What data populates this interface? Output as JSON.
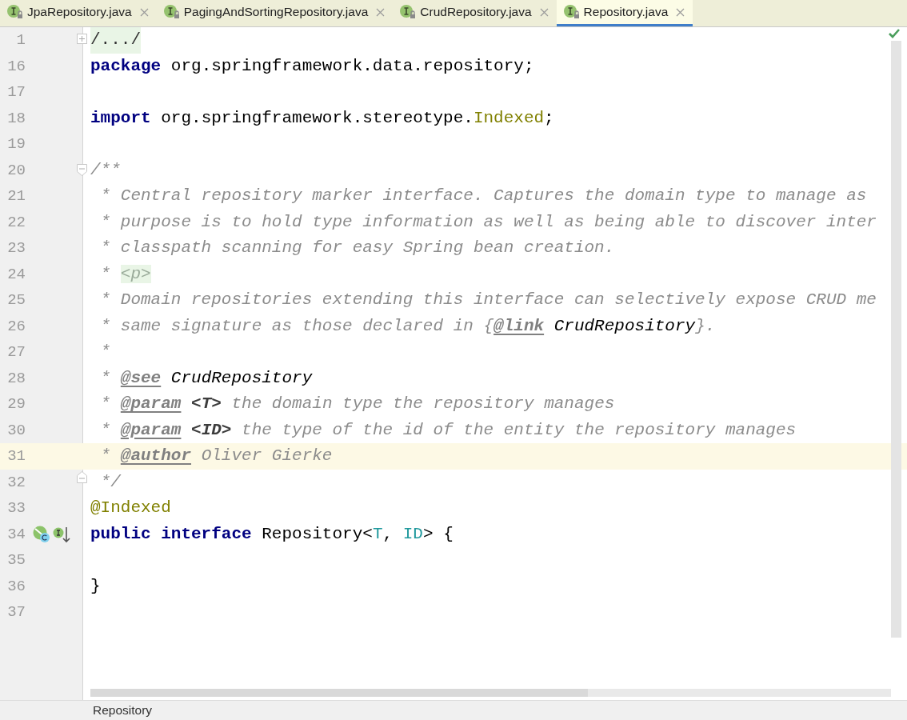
{
  "tabs": [
    {
      "label": "JpaRepository.java",
      "selected": false
    },
    {
      "label": "PagingAndSortingRepository.java",
      "selected": false
    },
    {
      "label": "CrudRepository.java",
      "selected": false
    },
    {
      "label": "Repository.java",
      "selected": true
    }
  ],
  "editor": {
    "lines": [
      {
        "number": "1",
        "current": false,
        "fold": {
          "kind": "expand"
        },
        "tokens": [
          {
            "kind": "folded",
            "text": "/.../"
          }
        ]
      },
      {
        "number": "16",
        "current": false,
        "tokens": [
          {
            "kind": "keyword",
            "text": "package"
          },
          {
            "kind": "plain",
            "text": " org.springframework.data.repository;"
          }
        ]
      },
      {
        "number": "17",
        "current": false
      },
      {
        "number": "18",
        "current": false,
        "tokens": [
          {
            "kind": "keyword",
            "text": "import"
          },
          {
            "kind": "plain",
            "text": " org.springframework.stereotype."
          },
          {
            "kind": "annotation",
            "text": "Indexed"
          },
          {
            "kind": "plain",
            "text": ";"
          }
        ]
      },
      {
        "number": "19",
        "current": false
      },
      {
        "number": "20",
        "current": false,
        "fold": {
          "kind": "start"
        },
        "tokens": [
          {
            "kind": "comment",
            "text": "/**"
          }
        ]
      },
      {
        "number": "21",
        "current": false,
        "tokens": [
          {
            "kind": "comment",
            "text": " * Central repository marker interface. Captures the domain type to manage as"
          }
        ]
      },
      {
        "number": "22",
        "current": false,
        "tokens": [
          {
            "kind": "comment",
            "text": " * purpose is to hold type information as well as being able to discover inter"
          }
        ]
      },
      {
        "number": "23",
        "current": false,
        "tokens": [
          {
            "kind": "comment",
            "text": " * classpath scanning for easy Spring bean creation."
          }
        ]
      },
      {
        "number": "24",
        "current": false,
        "tokens": [
          {
            "kind": "comment",
            "text": " * "
          },
          {
            "kind": "html",
            "text": "<p>"
          }
        ]
      },
      {
        "number": "25",
        "current": false,
        "tokens": [
          {
            "kind": "comment",
            "text": " * Domain repositories extending this interface can selectively expose CRUD me"
          }
        ]
      },
      {
        "number": "26",
        "current": false,
        "tokens": [
          {
            "kind": "comment",
            "text": " * same signature as those declared in {"
          },
          {
            "kind": "doctag",
            "text": "@link"
          },
          {
            "kind": "docref",
            "text": " CrudRepository"
          },
          {
            "kind": "comment",
            "text": "}."
          }
        ]
      },
      {
        "number": "27",
        "current": false,
        "tokens": [
          {
            "kind": "comment",
            "text": " *"
          }
        ]
      },
      {
        "number": "28",
        "current": false,
        "tokens": [
          {
            "kind": "comment",
            "text": " * "
          },
          {
            "kind": "doctag",
            "text": "@see"
          },
          {
            "kind": "docref",
            "text": " CrudRepository"
          }
        ]
      },
      {
        "number": "29",
        "current": false,
        "tokens": [
          {
            "kind": "comment",
            "text": " * "
          },
          {
            "kind": "doctag",
            "text": "@param"
          },
          {
            "kind": "docparam",
            "text": " <T>"
          },
          {
            "kind": "comment",
            "text": " the domain type the repository manages"
          }
        ]
      },
      {
        "number": "30",
        "current": false,
        "tokens": [
          {
            "kind": "comment",
            "text": " * "
          },
          {
            "kind": "doctag",
            "text": "@param"
          },
          {
            "kind": "docparam",
            "text": " <ID>"
          },
          {
            "kind": "comment",
            "text": " the type of the id of the entity the repository manages"
          }
        ]
      },
      {
        "number": "31",
        "current": true,
        "tokens": [
          {
            "kind": "comment",
            "text": " * "
          },
          {
            "kind": "doctag",
            "text": "@author"
          },
          {
            "kind": "comment",
            "text": " Oliver Gierke"
          }
        ]
      },
      {
        "number": "32",
        "current": false,
        "fold": {
          "kind": "end"
        },
        "tokens": [
          {
            "kind": "comment",
            "text": " */"
          }
        ]
      },
      {
        "number": "33",
        "current": false,
        "tokens": [
          {
            "kind": "annotation",
            "text": "@Indexed"
          }
        ]
      },
      {
        "number": "34",
        "current": false,
        "markers": true,
        "tokens": [
          {
            "kind": "keyword",
            "text": "public interface"
          },
          {
            "kind": "plain",
            "text": " Repository<"
          },
          {
            "kind": "typeparam",
            "text": "T"
          },
          {
            "kind": "plain",
            "text": ", "
          },
          {
            "kind": "typeparam",
            "text": "ID"
          },
          {
            "kind": "plain",
            "text": "> {"
          }
        ]
      },
      {
        "number": "35",
        "current": false
      },
      {
        "number": "36",
        "current": false,
        "tokens": [
          {
            "kind": "plain",
            "text": "}"
          }
        ]
      },
      {
        "number": "37",
        "current": false
      }
    ]
  },
  "breadcrumb": "Repository"
}
